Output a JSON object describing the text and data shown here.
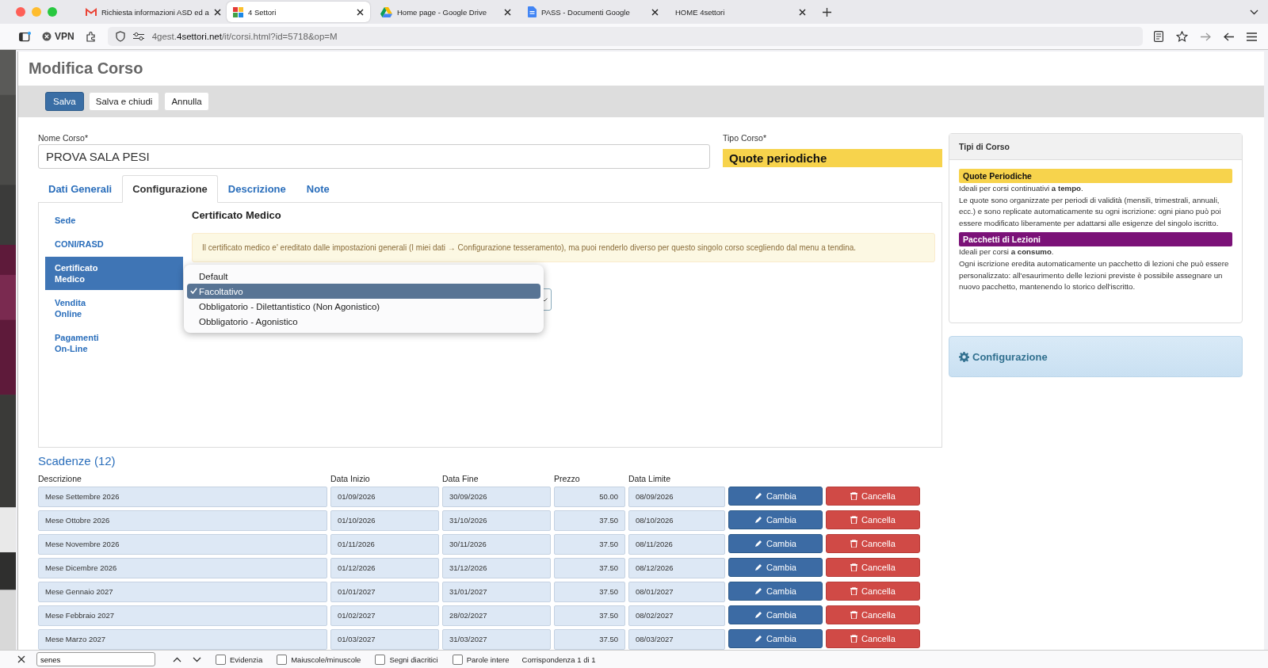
{
  "browser": {
    "tabs": [
      {
        "title": "Richiesta informazioni ASD ed a",
        "kind": "mail",
        "selected": false
      },
      {
        "title": "4 Settori",
        "kind": "grid",
        "selected": true
      },
      {
        "title": "Home page - Google Drive",
        "kind": "drive",
        "selected": false
      },
      {
        "title": "PASS - Documenti Google",
        "kind": "doc",
        "selected": false
      },
      {
        "title": "HOME 4settori",
        "kind": "plain",
        "selected": false
      }
    ],
    "vpn": "VPN",
    "url": "4gest.**4settori.net**/it/corsi.html?id=5718&op=M"
  },
  "page": {
    "title": "Modifica Corso",
    "toolbar": [
      {
        "label": "Salva",
        "primary": true
      },
      {
        "label": "Salva e chiudi",
        "primary": false
      },
      {
        "label": "Annulla",
        "primary": false
      }
    ]
  },
  "form": {
    "name_label": "Nome Corso*",
    "name_value": "PROVA SALA PESI",
    "type_label": "Tipo Corso*",
    "type_value": "Quote periodiche"
  },
  "tabs": [
    {
      "label": "Dati Generali",
      "selected": false
    },
    {
      "label": "Configurazione",
      "selected": true
    },
    {
      "label": "Descrizione",
      "selected": false
    },
    {
      "label": "Note",
      "selected": false
    }
  ],
  "side_nav": [
    {
      "label": "Sede",
      "selected": false
    },
    {
      "label": "CONI/RASD",
      "selected": false
    },
    {
      "label": "Certificato Medico",
      "selected": true
    },
    {
      "label": "Vendita Online",
      "selected": false
    },
    {
      "label": "Pagamenti On-Line",
      "selected": false
    }
  ],
  "section_title": "Certificato Medico",
  "notice": "Il certificato medico e' ereditato dalle impostazioni generali (I miei dati → Configurazione tesseramento), ma puoi renderlo diverso per questo singolo corso scegliendo dal menu a tendina.",
  "dropdown": {
    "options": [
      {
        "label": "Default",
        "selected": false
      },
      {
        "label": "Facoltativo",
        "selected": true
      },
      {
        "label": "Obbligatorio - Dilettantistico (Non Agonistico)",
        "selected": false
      },
      {
        "label": "Obbligatorio - Agonistico",
        "selected": false
      }
    ]
  },
  "info_panel": {
    "title": "Tipi di Corso",
    "types": [
      {
        "name": "Quote Periodiche",
        "color": "#f7d34c",
        "paragraphs": [
          "Ideali per corsi continuativi **a tempo**.",
          "Le quote sono organizzate per periodi di validità (mensili, trimestrali, annuali, ecc.) e sono replicate automaticamente su ogni iscrizione: ogni piano può poi essere modificato liberamente per adattarsi alle esigenze del singolo iscritto."
        ]
      },
      {
        "name": "Pacchetti di Lezioni",
        "color": "#7b1278",
        "paragraphs": [
          "Ideali per corsi **a consumo**.",
          "Ogni iscrizione eredita automaticamente un pacchetto di lezioni che può essere personalizzato: all'esaurimento delle lezioni previste è possibile assegnare un nuovo pacchetto, mantenendo lo storico dell'iscritto."
        ]
      }
    ]
  },
  "config_panel": {
    "title": "Configurazione"
  },
  "schedule": {
    "title": "Scadenze (12)",
    "columns": [
      "Descrizione",
      "Data Inizio",
      "Data Fine",
      "Prezzo",
      "Data Limite"
    ],
    "rows": [
      {
        "cells": [
          "Mese Settembre 2026",
          "01/09/2026",
          "30/09/2026",
          "50.00",
          "08/09/2026"
        ],
        "edit": "Cambia",
        "delete": "Cancella"
      },
      {
        "cells": [
          "Mese Ottobre 2026",
          "01/10/2026",
          "31/10/2026",
          "37.50",
          "08/10/2026"
        ],
        "edit": "Cambia",
        "delete": "Cancella"
      },
      {
        "cells": [
          "Mese Novembre 2026",
          "01/11/2026",
          "30/11/2026",
          "37.50",
          "08/11/2026"
        ],
        "edit": "Cambia",
        "delete": "Cancella"
      },
      {
        "cells": [
          "Mese Dicembre 2026",
          "01/12/2026",
          "31/12/2026",
          "37.50",
          "08/12/2026"
        ],
        "edit": "Cambia",
        "delete": "Cancella"
      },
      {
        "cells": [
          "Mese Gennaio 2027",
          "01/01/2027",
          "31/01/2027",
          "37.50",
          "08/01/2027"
        ],
        "edit": "Cambia",
        "delete": "Cancella"
      },
      {
        "cells": [
          "Mese Febbraio 2027",
          "01/02/2027",
          "28/02/2027",
          "37.50",
          "08/02/2027"
        ],
        "edit": "Cambia",
        "delete": "Cancella"
      },
      {
        "cells": [
          "Mese Marzo 2027",
          "01/03/2027",
          "31/03/2027",
          "37.50",
          "08/03/2027"
        ],
        "edit": "Cambia",
        "delete": "Cancella"
      }
    ]
  },
  "find_bar": {
    "query": "senes",
    "options": [
      {
        "label": "Evidenzia",
        "checked": false
      },
      {
        "label": "Maiuscole/minuscole",
        "checked": false
      },
      {
        "label": "Segni diacritici",
        "checked": false
      },
      {
        "label": "Parole intere",
        "checked": false
      }
    ],
    "status": "Corrispondenza 1 di 1"
  }
}
